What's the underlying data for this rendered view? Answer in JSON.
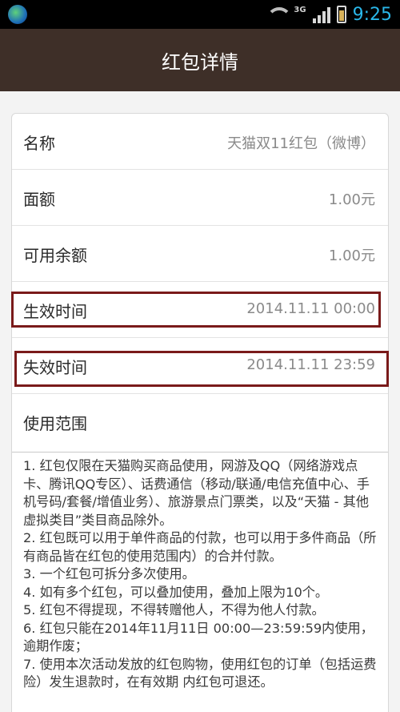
{
  "status_bar": {
    "network": "3G",
    "time": "9:25"
  },
  "header": {
    "title": "红包详情"
  },
  "details": [
    {
      "label": "名称",
      "value": "天猫双11红包（微博）"
    },
    {
      "label": "面额",
      "value": "1.00元"
    },
    {
      "label": "可用余额",
      "value": "1.00元"
    },
    {
      "label": "生效时间",
      "value": "2014.11.11 00:00"
    },
    {
      "label": "失效时间",
      "value": "2014.11.11 23:59"
    },
    {
      "label": "使用范围",
      "value": ""
    }
  ],
  "scope_lines": [
    "1. 红包仅限在天猫购买商品使用，网游及QQ（网络游戏点卡、腾讯QQ专区）、话费通信（移动/联通/电信充值中心、手机号码/套餐/增值业务）、旅游景点门票类，以及“天猫 - 其他虚拟类目”类目商品除外。",
    "2. 红包既可以用于单件商品的付款，也可以用于多件商品（所有商品皆在红包的使用范围内）的合并付款。",
    "3. 一个红包可拆分多次使用。",
    "4. 如有多个红包，可以叠加使用，叠加上限为10个。",
    "5. 红包不得提现，不得转赠他人，不得为他人付款。",
    "6. 红包只能在2014年11月11日 00:00—23:59:59内使用，逾期作废；",
    "7. 使用本次活动发放的红包购物，使用红包的订单（包括运费险）发生退款时，在有效期 内红包可退还。"
  ]
}
